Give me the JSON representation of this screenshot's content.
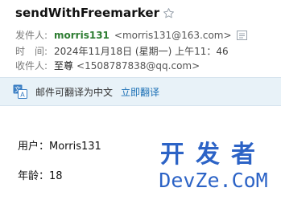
{
  "email": {
    "subject": "sendWithFreemarker",
    "sender_label": "发件人:",
    "sender_name": "morris131",
    "sender_email": "<morris131@163.com>",
    "time_label": "时　间:",
    "time_value": "2024年11月18日 (星期一) 上午11：46",
    "recipient_label": "收件人:",
    "recipient_name": "至尊",
    "recipient_email": "<1508787838@qq.com>"
  },
  "translate_bar": {
    "text": "邮件可翻译为中文",
    "link": "立即翻译"
  },
  "body": {
    "user_line": "用户：Morris131",
    "age_line": "年龄：18"
  },
  "watermark": {
    "top": "开发者",
    "bottom": "DevZe.CoM"
  },
  "colors": {
    "sender_name": "#2e7d32",
    "link": "#1a6fb5",
    "translate_bg": "#e8f2f8",
    "watermark": "#2c63c6"
  }
}
